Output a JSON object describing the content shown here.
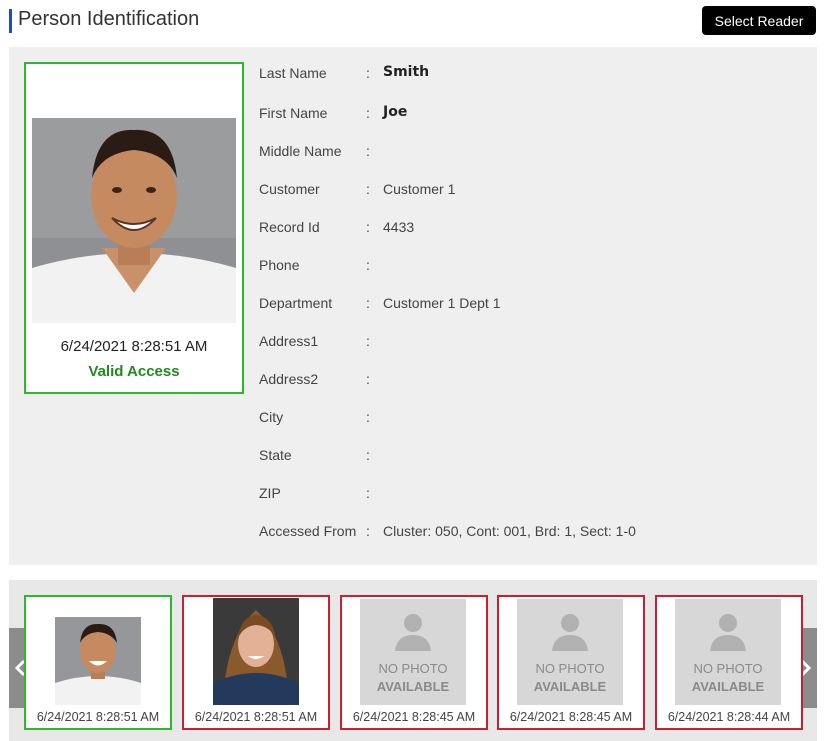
{
  "header": {
    "title": "Person Identification",
    "select_reader_label": "Select Reader"
  },
  "current": {
    "timestamp": "6/24/2021 8:28:51 AM",
    "status": "Valid Access",
    "status_color": "#1f8a1f",
    "border_color": "#2db82d"
  },
  "fields": [
    {
      "label": "Last Name",
      "colon": ":",
      "value": "Smith"
    },
    {
      "label": "First Name",
      "colon": ":",
      "value": "Joe"
    },
    {
      "label": "Middle Name",
      "colon": ":",
      "value": ""
    },
    {
      "label": "Customer",
      "colon": ":",
      "value": "Customer 1"
    },
    {
      "label": "Record Id",
      "colon": ":",
      "value": "4433"
    },
    {
      "label": "Phone",
      "colon": ":",
      "value": ""
    },
    {
      "label": "Department",
      "colon": ":",
      "value": "Customer 1 Dept 1"
    },
    {
      "label": "Address1",
      "colon": ":",
      "value": ""
    },
    {
      "label": "Address2",
      "colon": ":",
      "value": ""
    },
    {
      "label": "City",
      "colon": ":",
      "value": ""
    },
    {
      "label": "State",
      "colon": ":",
      "value": ""
    },
    {
      "label": "ZIP",
      "colon": ":",
      "value": ""
    },
    {
      "label": "Accessed From",
      "colon": ":",
      "value": "Cluster: 050, Cont: 001, Brd: 1, Sect: 1-0"
    }
  ],
  "history": {
    "prev_icon": "chevron-left-icon",
    "next_icon": "chevron-right-icon",
    "items": [
      {
        "time": "6/24/2021 8:28:51 AM",
        "photo": "man",
        "status_color": "#2db82d"
      },
      {
        "time": "6/24/2021 8:28:51 AM",
        "photo": "woman",
        "status_color": "#c8202f"
      },
      {
        "time": "6/24/2021 8:28:45 AM",
        "photo": "none",
        "status_color": "#c8202f",
        "no_photo_line1": "NO PHOTO",
        "no_photo_line2": "AVAILABLE"
      },
      {
        "time": "6/24/2021 8:28:45 AM",
        "photo": "none",
        "status_color": "#c8202f",
        "no_photo_line1": "NO PHOTO",
        "no_photo_line2": "AVAILABLE"
      },
      {
        "time": "6/24/2021 8:28:44 AM",
        "photo": "none",
        "status_color": "#c8202f",
        "no_photo_line1": "NO PHOTO",
        "no_photo_line2": "AVAILABLE"
      }
    ]
  }
}
